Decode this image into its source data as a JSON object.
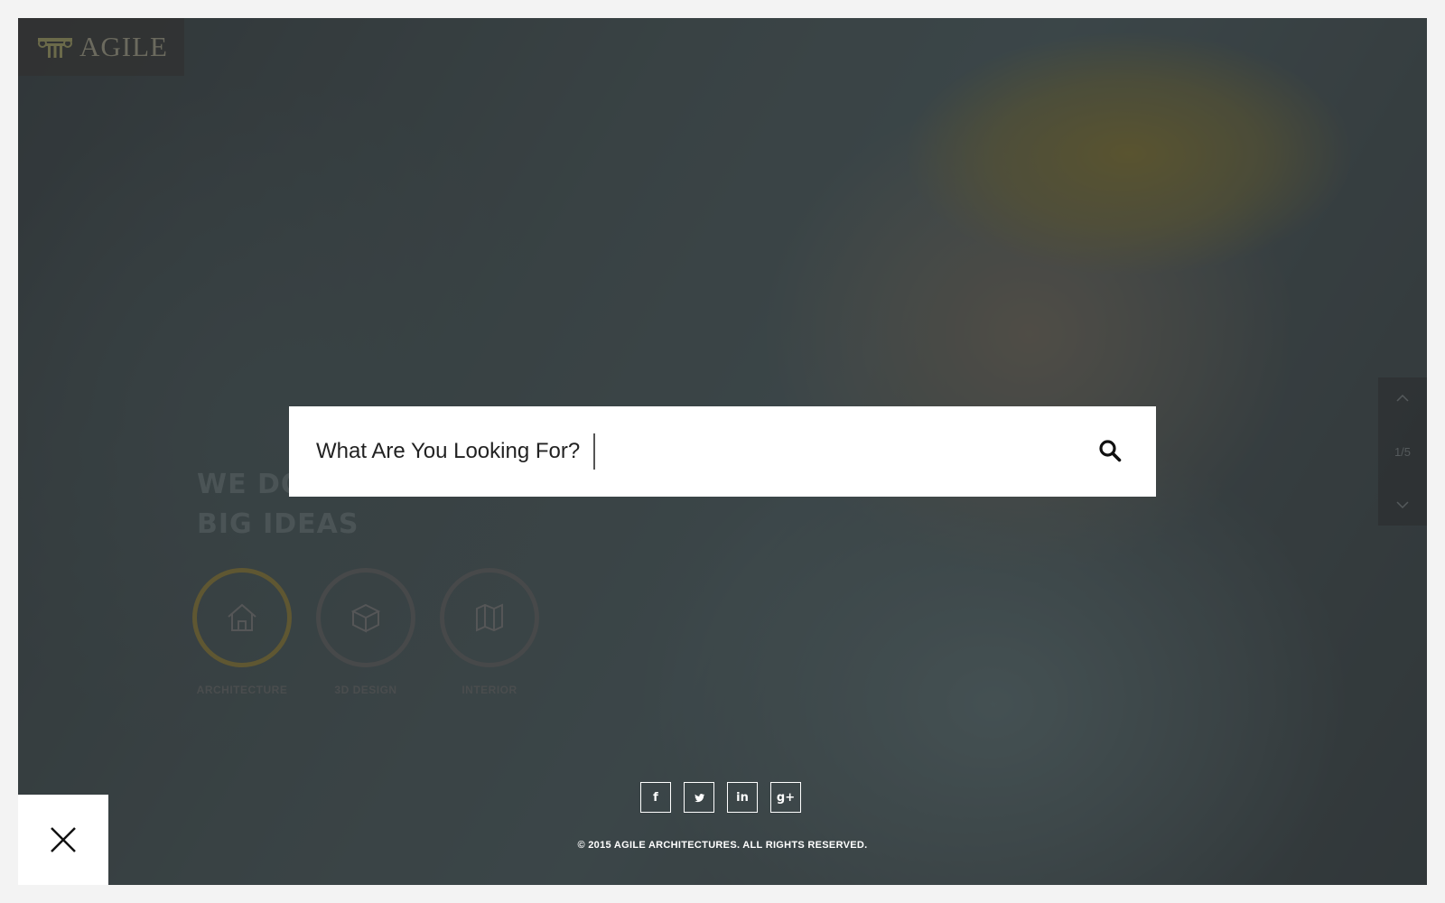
{
  "brand": {
    "name": "AGILE",
    "logo_icon": "column-capital-icon"
  },
  "hero": {
    "title_line1": "WE DO",
    "title_line2": "BIG IDEAS"
  },
  "services": [
    {
      "label": "ARCHITECTURE",
      "icon": "house-icon",
      "active": true
    },
    {
      "label": "3D DESIGN",
      "icon": "cube-icon",
      "active": false
    },
    {
      "label": "INTERIOR",
      "icon": "map-icon",
      "active": false
    }
  ],
  "slider": {
    "counter": "1/5",
    "up_icon": "chevron-up-icon",
    "down_icon": "chevron-down-icon"
  },
  "search": {
    "placeholder": "What Are You Looking For?",
    "value": "",
    "icon": "search-icon"
  },
  "social": [
    {
      "name": "facebook",
      "glyph": "f"
    },
    {
      "name": "twitter",
      "glyph": "t"
    },
    {
      "name": "linkedin",
      "glyph": "in"
    },
    {
      "name": "google-plus",
      "glyph": "g+"
    }
  ],
  "footer": {
    "copyright": "© 2015 AGILE ARCHITECTURES. ALL RIGHTS RESERVED."
  },
  "colors": {
    "accent": "#c9a227",
    "overlay": "#2c2e31",
    "search_bg": "#ffffff"
  }
}
